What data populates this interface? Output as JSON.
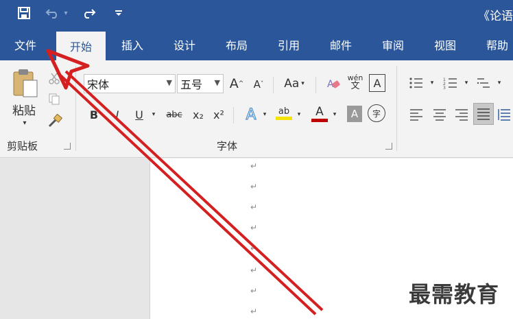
{
  "title_bar": {
    "doc_title": "《论语"
  },
  "quick_access": [
    {
      "name": "save-icon",
      "glyph": "🖫"
    },
    {
      "name": "undo-icon",
      "glyph": "↶"
    },
    {
      "name": "redo-icon",
      "glyph": "↷"
    },
    {
      "name": "customize-qat-icon",
      "glyph": "⌄"
    }
  ],
  "tabs": [
    {
      "label": "文件"
    },
    {
      "label": "开始",
      "active": true
    },
    {
      "label": "插入"
    },
    {
      "label": "设计"
    },
    {
      "label": "布局"
    },
    {
      "label": "引用"
    },
    {
      "label": "邮件"
    },
    {
      "label": "审阅"
    },
    {
      "label": "视图"
    },
    {
      "label": "帮助"
    }
  ],
  "clipboard": {
    "paste_label": "粘贴",
    "group_label": "剪贴板"
  },
  "font": {
    "font_name": "宋体",
    "font_size": "五号",
    "grow_label": "A",
    "shrink_label": "A",
    "case_label": "Aa",
    "phonetic_top": "wén",
    "phonetic_bottom": "文",
    "border_label": "A",
    "bold": "B",
    "italic": "I",
    "underline": "U",
    "strike": "abc",
    "sub": "x₂",
    "sup": "x²",
    "effects": "A",
    "highlight": "ab",
    "color_a": "A",
    "shade": "A",
    "enclose": "字",
    "group_label": "字体"
  },
  "watermark": "最需教育",
  "colors": {
    "accent": "#2b579a",
    "arrow": "#d42020",
    "highlight": "#f4e300",
    "font_red": "#c00000"
  }
}
